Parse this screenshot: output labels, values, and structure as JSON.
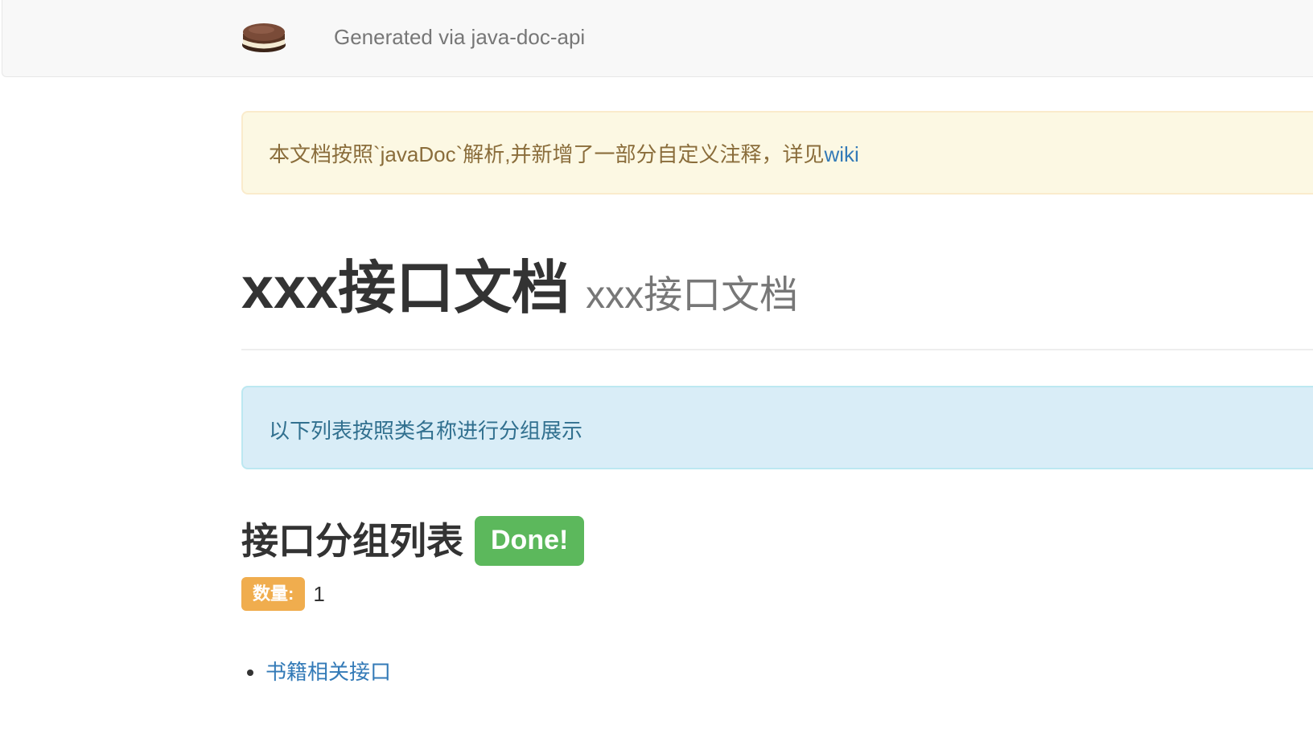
{
  "navbar": {
    "logo_icon": "sandwich-cake-icon",
    "brand": "Generated via java-doc-api"
  },
  "notice": {
    "text": "本文档按照`javaDoc`解析,并新增了一部分自定义注释，详见",
    "link_label": "wiki"
  },
  "header": {
    "title": "xxx接口文档",
    "subtitle": "xxx接口文档"
  },
  "info": {
    "text": "以下列表按照类名称进行分组展示"
  },
  "group_section": {
    "title": "接口分组列表",
    "status_badge": "Done!",
    "count_label": "数量:",
    "count_value": "1",
    "items": [
      {
        "label": "书籍相关接口"
      }
    ]
  },
  "colors": {
    "success": "#5cb85c",
    "warning": "#f0ad4e",
    "link": "#337ab7",
    "warning_bg": "#fcf8e3",
    "info_bg": "#d9edf7"
  }
}
